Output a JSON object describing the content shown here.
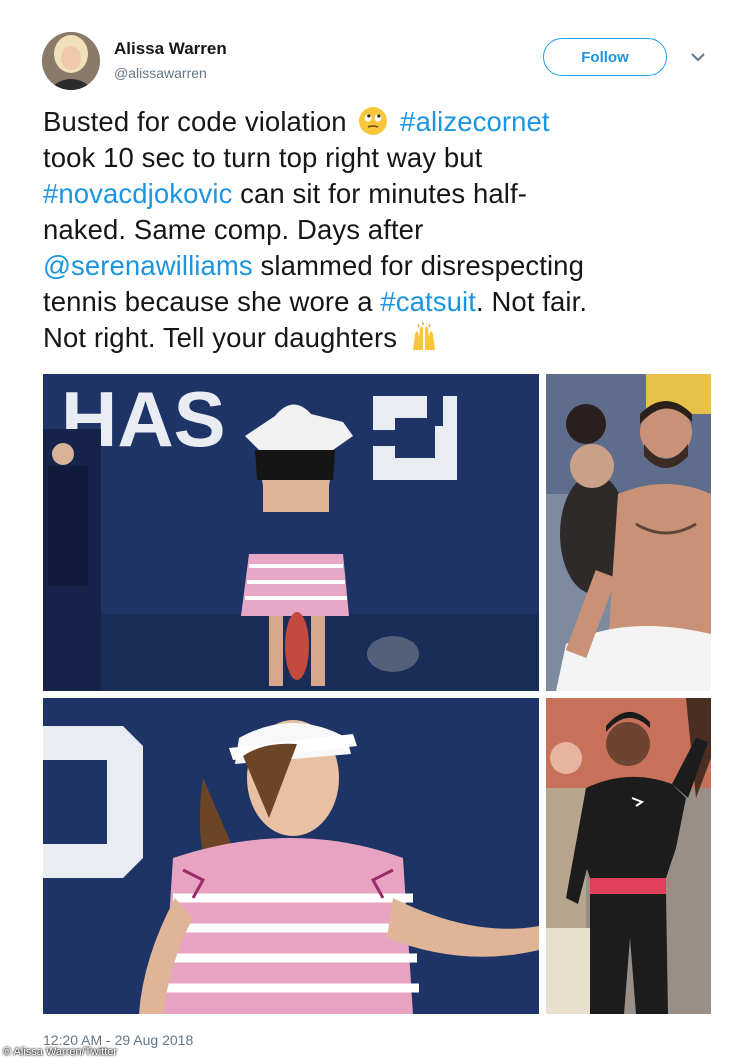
{
  "author": {
    "name": "Alissa Warren",
    "handle": "@alissawarren"
  },
  "follow_label": "Follow",
  "tweet": {
    "line1": {
      "text": "Busted for code violation",
      "tag": "#alizecornet"
    },
    "line2": "took 10 sec to turn top right way but",
    "line3": {
      "tag": "#novacdjokovic",
      "text": " can sit for minutes half-"
    },
    "line4": "naked. Same comp. Days after",
    "line5": {
      "tag": "@serenawilliams",
      "text": " slammed for disrespecting"
    },
    "line6": {
      "pre": "tennis because she wore a ",
      "tag": "#catsuit",
      "post": ". Not fair."
    },
    "line7": "Not right. Tell your daughters"
  },
  "icons": [
    "avatar",
    "chevron-down-icon",
    "eye-roll-emoji",
    "raised-hands-emoji"
  ],
  "banner_letters": "HAS",
  "timestamp": "12:20 AM - 29 Aug 2018",
  "credit": "© Alissa Warren/Twitter",
  "colors": {
    "link": "#1b95e0",
    "follow_border": "#1da1f2",
    "secondary": "#657786",
    "court_blue": "#1e3466"
  }
}
